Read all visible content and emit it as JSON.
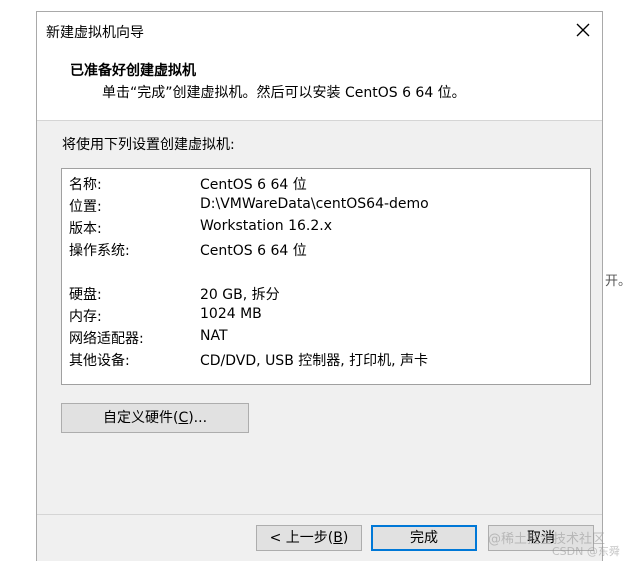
{
  "window": {
    "title": "新建虚拟机向导",
    "close_icon": "close-icon"
  },
  "header": {
    "heading": "已准备好创建虚拟机",
    "subheading": "单击“完成”创建虚拟机。然后可以安装 CentOS 6 64 位。"
  },
  "intro": "将使用下列设置创建虚拟机:",
  "summary": {
    "rows": [
      {
        "label": "名称:",
        "value": "CentOS 6 64 位"
      },
      {
        "label": "位置:",
        "value": "D:\\VMWareData\\centOS64-demo"
      },
      {
        "label": "版本:",
        "value": "Workstation 16.2.x"
      },
      {
        "label": "操作系统:",
        "value": "CentOS 6 64 位"
      },
      {
        "label": "硬盘:",
        "value": "20 GB, 拆分"
      },
      {
        "label": "内存:",
        "value": "1024 MB"
      },
      {
        "label": "网络适配器:",
        "value": "NAT"
      },
      {
        "label": "其他设备:",
        "value": "CD/DVD, USB 控制器, 打印机, 声卡"
      }
    ]
  },
  "customize_button": {
    "prefix": "自定义硬件(",
    "mnemonic": "C",
    "suffix": ")..."
  },
  "footer": {
    "back": {
      "prefix": "< 上一步(",
      "mnemonic": "B",
      "suffix": ")"
    },
    "finish": "完成",
    "cancel": "取消"
  },
  "background": {
    "side_fragment": "开。",
    "watermark_main": "@稀土掘金技术社区",
    "watermark_sub": "CSDN @东舜"
  }
}
